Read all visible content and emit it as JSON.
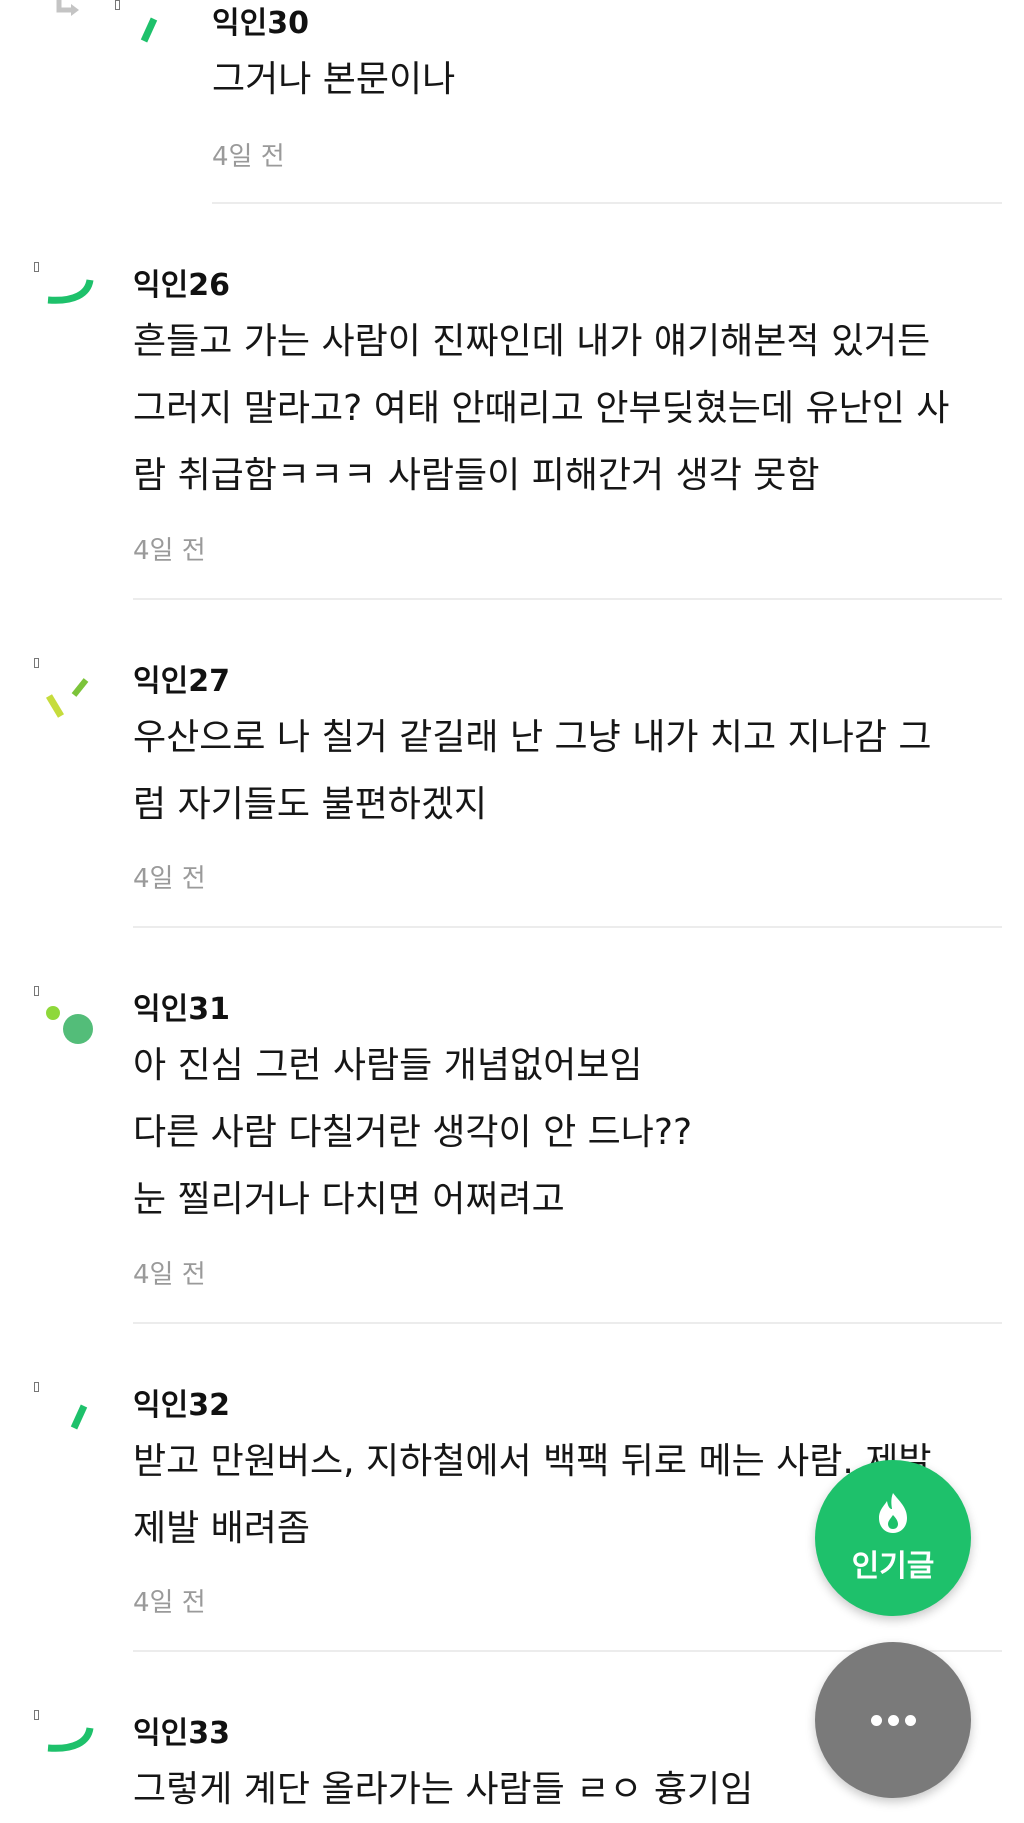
{
  "comments": [
    {
      "author": "익인30",
      "lines": [
        "그거나 본문이나"
      ],
      "time": "4일 전",
      "is_reply": true
    },
    {
      "author": "익인26",
      "lines": [
        "흔들고 가는 사람이 진짜인데 내가 얘기해본적 있거든",
        "그러지 말라고? 여태 안때리고 안부딪혔는데 유난인 사",
        "람 취급함ㅋㅋㅋ 사람들이 피해간거 생각 못함"
      ],
      "time": "4일 전"
    },
    {
      "author": "익인27",
      "lines": [
        "우산으로 나 칠거 같길래 난 그냥 내가 치고 지나감 그",
        "럼 자기들도 불편하겠지"
      ],
      "time": "4일 전"
    },
    {
      "author": "익인31",
      "lines": [
        "아 진심 그런 사람들 개념없어보임",
        "다른 사람 다칠거란 생각이 안 드나??",
        "눈 찔리거나 다치면 어쩌려고"
      ],
      "time": "4일 전"
    },
    {
      "author": "익인32",
      "lines": [
        "받고 만원버스, 지하철에서 백팩 뒤로 메는 사람. 제발",
        "제발 배려좀"
      ],
      "time": "4일 전"
    },
    {
      "author": "익인33",
      "lines": [
        "그렇게 계단 올라가는 사람들 ㄹㅇ 흉기임"
      ],
      "time": ""
    }
  ],
  "fab": {
    "popular_label": "인기글",
    "popular_icon": "fire-icon",
    "more_icon": "more-dots-icon"
  },
  "colors": {
    "accent_green": "#1ec16b",
    "fab_gray": "#7a7a7a",
    "time_gray": "#9a9a9a"
  }
}
